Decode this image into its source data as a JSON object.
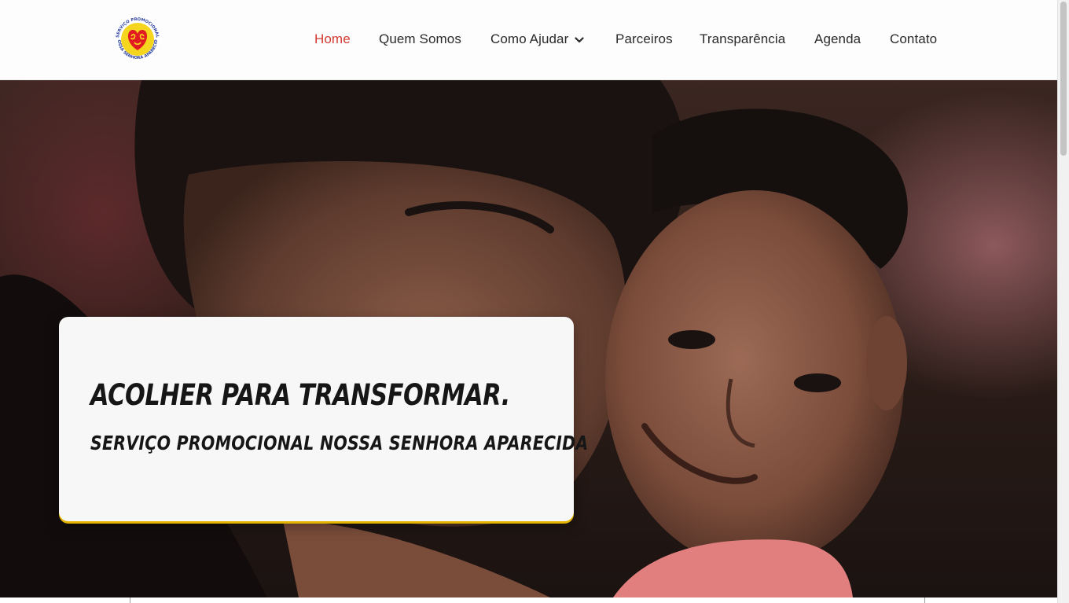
{
  "header": {
    "logo": {
      "ring_top_text": "SERVIÇO PROMOCIONAL",
      "ring_bottom_text": "NOSSA SENHORA APARECIDA"
    },
    "nav": [
      {
        "label": "Home",
        "active": true
      },
      {
        "label": "Quem Somos",
        "active": false
      },
      {
        "label": "Como Ajudar",
        "active": false,
        "has_dropdown": true
      },
      {
        "label": "Parceiros",
        "active": false
      },
      {
        "label": "Transparência",
        "active": false
      },
      {
        "label": "Agenda",
        "active": false
      },
      {
        "label": "Contato",
        "active": false
      }
    ]
  },
  "hero": {
    "title": "Acolher para transformar.",
    "subtitle": "Serviço Promocional Nossa Senhora Aparecida"
  },
  "colors": {
    "accent": "#d23a31",
    "card_border": "#e3b400",
    "nav_text": "#2a2a2a",
    "logo_yellow": "#f6d51f",
    "logo_red": "#e11b22"
  }
}
